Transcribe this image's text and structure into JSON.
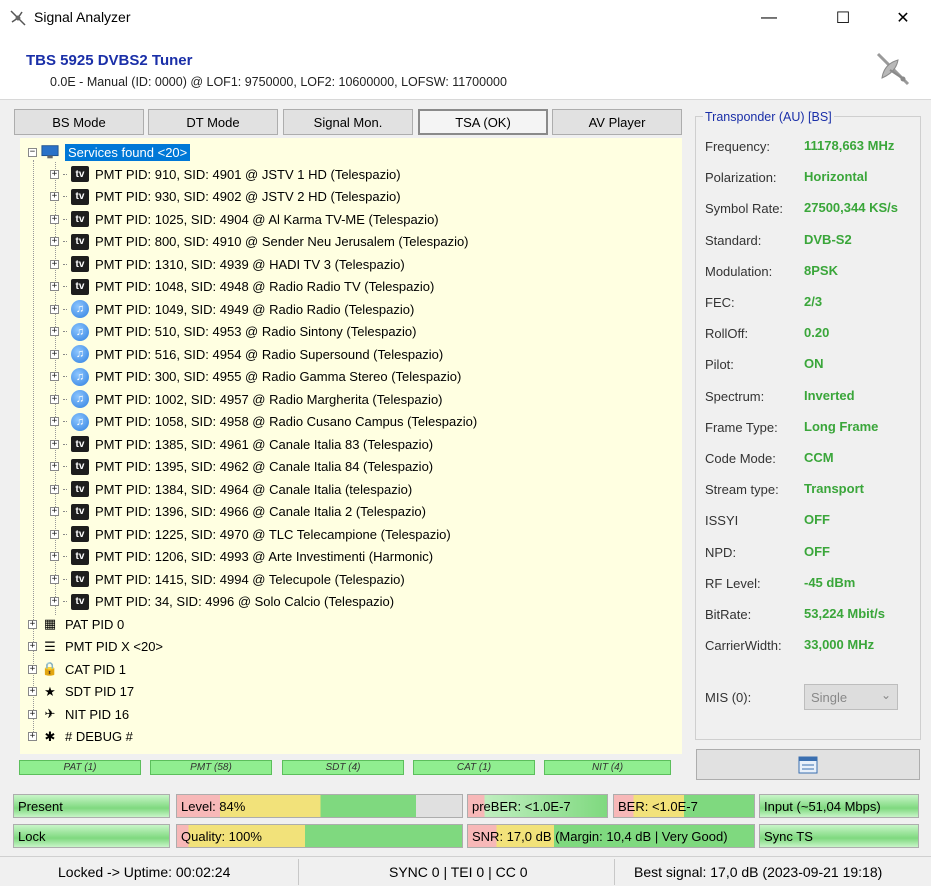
{
  "window": {
    "title": "Signal Analyzer",
    "minimize": "—",
    "maximize": "☐",
    "close": "✕"
  },
  "header": {
    "tuner_name": "TBS 5925 DVBS2 Tuner",
    "tuner_info": "0.0E - Manual (ID: 0000) @ LOF1: 9750000, LOF2: 10600000, LOFSW: 11700000"
  },
  "tabs": [
    {
      "label": "BS Mode"
    },
    {
      "label": "DT Mode"
    },
    {
      "label": "Signal Mon."
    },
    {
      "label": "TSA (OK)"
    },
    {
      "label": "AV Player"
    }
  ],
  "tree": {
    "root_label": "Services found <20>",
    "services": [
      {
        "label": "PMT PID: 910, SID: 4901 @ JSTV 1 HD (Telespazio)",
        "icon": "tv-icon"
      },
      {
        "label": "PMT PID: 930, SID: 4902 @ JSTV 2 HD (Telespazio)",
        "icon": "tv-icon"
      },
      {
        "label": "PMT PID: 1025, SID: 4904 @ Al Karma TV-ME (Telespazio)",
        "icon": "tv-icon"
      },
      {
        "label": "PMT PID: 800, SID: 4910 @ Sender Neu Jerusalem (Telespazio)",
        "icon": "tv-icon"
      },
      {
        "label": "PMT PID: 1310, SID: 4939 @ HADI TV 3 (Telespazio)",
        "icon": "tv-icon"
      },
      {
        "label": "PMT PID: 1048, SID: 4948 @ Radio Radio TV (Telespazio)",
        "icon": "tv-icon"
      },
      {
        "label": "PMT PID: 1049, SID: 4949 @ Radio Radio (Telespazio)",
        "icon": "radio-icon"
      },
      {
        "label": "PMT PID: 510, SID: 4953 @ Radio Sintony (Telespazio)",
        "icon": "radio-icon"
      },
      {
        "label": "PMT PID: 516, SID: 4954 @ Radio Supersound (Telespazio)",
        "icon": "radio-icon"
      },
      {
        "label": "PMT PID: 300, SID: 4955 @ Radio Gamma Stereo (Telespazio)",
        "icon": "radio-icon"
      },
      {
        "label": "PMT PID: 1002, SID: 4957 @ Radio Margherita (Telespazio)",
        "icon": "radio-icon"
      },
      {
        "label": "PMT PID: 1058, SID: 4958 @ Radio Cusano Campus (Telespazio)",
        "icon": "radio-icon"
      },
      {
        "label": "PMT PID: 1385, SID: 4961 @ Canale Italia 83 (Telespazio)",
        "icon": "tv-icon"
      },
      {
        "label": "PMT PID: 1395, SID: 4962 @ Canale Italia 84 (Telespazio)",
        "icon": "tv-icon"
      },
      {
        "label": "PMT PID: 1384, SID: 4964 @ Canale Italia (telespazio)",
        "icon": "tv-icon"
      },
      {
        "label": "PMT PID: 1396, SID: 4966 @ Canale Italia 2 (Telespazio)",
        "icon": "tv-icon"
      },
      {
        "label": "PMT PID: 1225, SID: 4970 @ TLC Telecampione (Telespazio)",
        "icon": "tv-icon"
      },
      {
        "label": "PMT PID: 1206, SID: 4993 @ Arte Investimenti (Harmonic)",
        "icon": "tv-icon"
      },
      {
        "label": "PMT PID: 1415, SID: 4994 @ Telecupole (Telespazio)",
        "icon": "tv-icon"
      },
      {
        "label": "PMT PID: 34, SID: 4996 @ Solo Calcio (Telespazio)",
        "icon": "tv-icon"
      }
    ],
    "tv_glyph": "tv",
    "radio_glyph": "♫",
    "sections": [
      {
        "label": "PAT PID 0",
        "icon": "table-icon",
        "glyph": "▦"
      },
      {
        "label": "PMT PID X <20>",
        "icon": "list-icon",
        "glyph": "☰"
      },
      {
        "label": "CAT PID 1",
        "icon": "lock-icon",
        "glyph": "🔒"
      },
      {
        "label": "SDT PID 17",
        "icon": "star-doc-icon",
        "glyph": "★"
      },
      {
        "label": "NIT PID 16",
        "icon": "satellite-icon",
        "glyph": "✈"
      },
      {
        "label": "# DEBUG #",
        "icon": "bug-icon",
        "glyph": "✱"
      }
    ]
  },
  "pid_bar": [
    "PAT (1)",
    "PMT (58)",
    "SDT (4)",
    "CAT (1)",
    "NIT (4)"
  ],
  "transponder": {
    "title": "Transponder (AU) [BS]",
    "rows": [
      {
        "label": "Frequency:",
        "value": "11178,663 MHz"
      },
      {
        "label": "Polarization:",
        "value": "Horizontal"
      },
      {
        "label": "Symbol Rate:",
        "value": "27500,344 KS/s"
      },
      {
        "label": "Standard:",
        "value": "DVB-S2"
      },
      {
        "label": "Modulation:",
        "value": "8PSK"
      },
      {
        "label": "FEC:",
        "value": "2/3"
      },
      {
        "label": "RollOff:",
        "value": "0.20"
      },
      {
        "label": "Pilot:",
        "value": "ON"
      },
      {
        "label": "Spectrum:",
        "value": "Inverted"
      },
      {
        "label": "Frame Type:",
        "value": "Long Frame"
      },
      {
        "label": "Code Mode:",
        "value": "CCM"
      },
      {
        "label": "Stream type:",
        "value": "Transport"
      },
      {
        "label": "ISSYI",
        "value": "OFF"
      },
      {
        "label": "NPD:",
        "value": "OFF"
      },
      {
        "label": "RF Level:",
        "value": "-45 dBm"
      },
      {
        "label": "BitRate:",
        "value": "53,224 Mbit/s"
      },
      {
        "label": "CarrierWidth:",
        "value": "33,000 MHz"
      }
    ],
    "mis_label": "MIS (0):",
    "mis_value": "Single"
  },
  "meters": {
    "present": "Present",
    "level": "Level: 84%",
    "level_fraction": 0.84,
    "preber": "preBER: <1.0E-7",
    "ber": "BER: <1.0E-7",
    "input": "Input (~51,04 Mbps)",
    "lock": "Lock",
    "quality": "Quality: 100%",
    "quality_fraction": 1.0,
    "snr": "SNR: 17,0 dB (Margin: 10,4 dB | Very Good)",
    "sync": "Sync TS"
  },
  "statusbar": {
    "uptime": "Locked -> Uptime: 00:02:24",
    "counters": "SYNC 0 | TEI 0 | CC 0",
    "best_signal": "Best signal: 17,0 dB (2023-09-21 19:18)"
  },
  "colors": {
    "accent": "#1a2fa8",
    "value_green": "#3aa63a",
    "tree_bg": "#ffffe1",
    "selection": "#0078d7"
  }
}
